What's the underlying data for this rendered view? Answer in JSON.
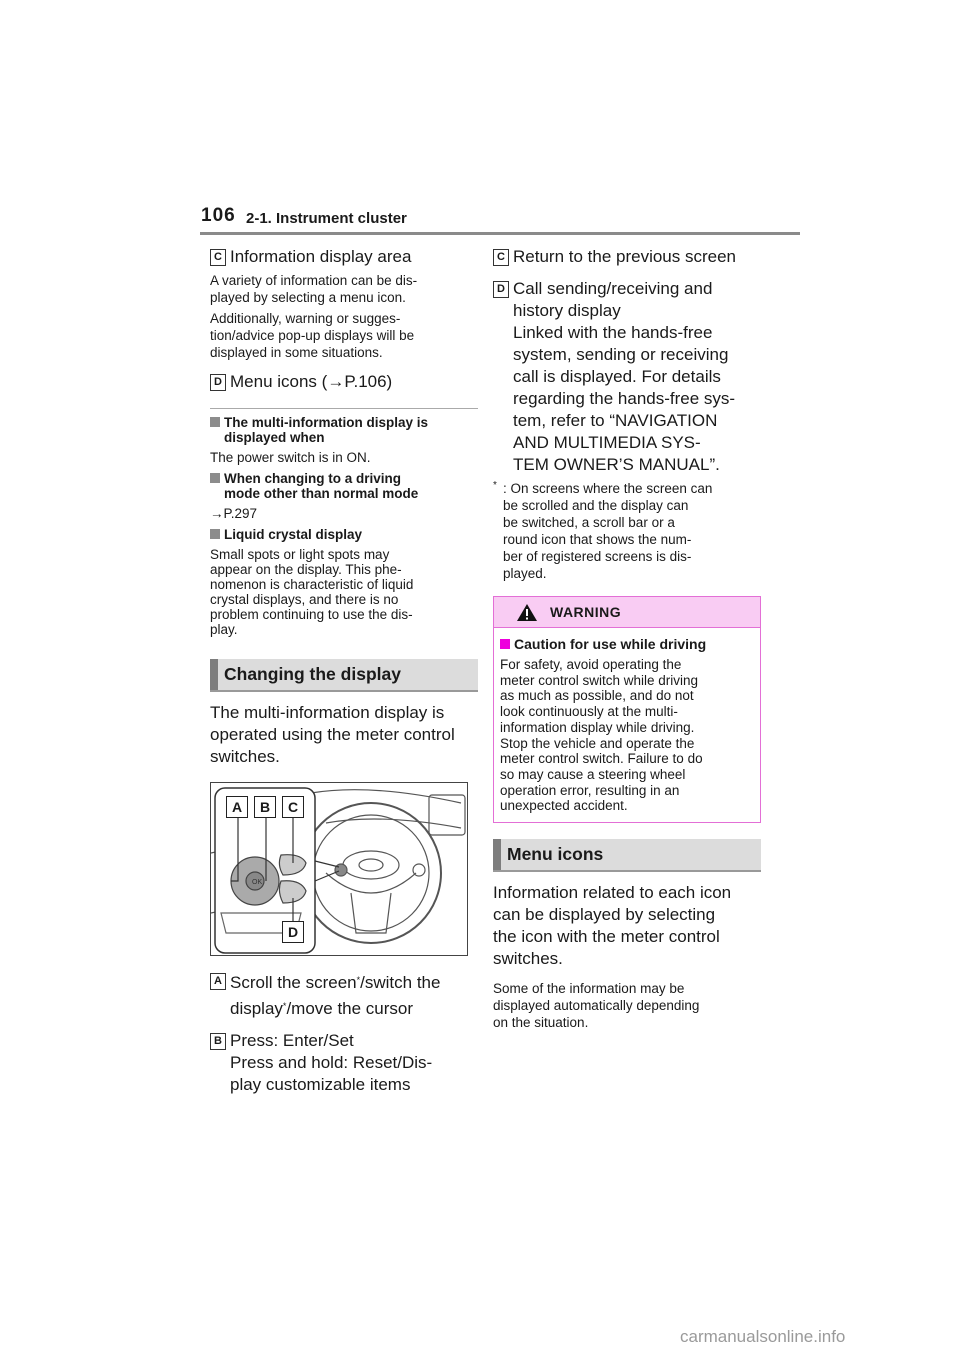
{
  "header": {
    "page_number": "106",
    "section": "2-1. Instrument cluster"
  },
  "left_column": {
    "item_c": {
      "label": "C",
      "title": "Information display area"
    },
    "item_c_desc_1": "A variety of information can be dis-\nplayed by selecting a menu icon.",
    "item_c_desc_2": "Additionally, warning or sugges-\ntion/advice pop-up displays will be\ndisplayed in some situations.",
    "item_d": {
      "label": "D",
      "title": "Menu icons (→P.106)"
    },
    "notes": [
      {
        "heading": "The multi-information display is\ndisplayed when",
        "body": "The power switch is in ON."
      },
      {
        "heading": "When changing to a driving\nmode other than normal mode",
        "body": "→P.297"
      },
      {
        "heading": "Liquid crystal display",
        "body": "Small spots or light spots may\nappear on the display. This phe-\nnomenon is characteristic of liquid\ncrystal displays, and there is no\nproblem continuing to use the dis-\nplay."
      }
    ],
    "changing_heading": "Changing the display",
    "changing_body": "The multi-information display is\noperated using the meter control\nswitches.",
    "figure": {
      "labels": [
        "A",
        "B",
        "C",
        "D"
      ],
      "alt": "Steering wheel meter control switches"
    },
    "item_a": {
      "label": "A",
      "part1": "Scroll the screen",
      "star": "*",
      "part2": "/switch the",
      "part3": "display",
      "part4": "/move the cursor"
    },
    "item_b": {
      "label": "B",
      "text": "Press: Enter/Set\nPress and hold: Reset/Dis-\nplay customizable items"
    }
  },
  "right_column": {
    "item_c": {
      "label": "C",
      "title": "Return to the previous screen"
    },
    "item_d": {
      "label": "D",
      "text": "Call sending/receiving and\nhistory display\nLinked with the hands-free\nsystem, sending or receiving\ncall is displayed. For details\nregarding the hands-free sys-\ntem, refer to “NAVIGATION\nAND MULTIMEDIA SYS-\nTEM OWNER’S MANUAL”."
    },
    "footnote": {
      "star": "*",
      "text": ": On screens where the screen can\nbe scrolled and the display can\nbe switched, a scroll bar or a\nround icon that shows the num-\nber of registered screens is dis-\nplayed."
    },
    "warning": {
      "title": "WARNING",
      "heading": "Caution for use while driving",
      "body": "For safety, avoid operating the\nmeter control switch while driving\nas much as possible, and do not\nlook continuously at the multi-\ninformation display while driving.\nStop the vehicle and operate the\nmeter control switch. Failure to do\nso may cause a steering wheel\noperation error, resulting in an\nunexpected accident."
    },
    "menu_heading": "Menu icons",
    "menu_body": "Information related to each icon\ncan be displayed by selecting\nthe icon with the meter control\nswitches.",
    "menu_small": "Some of the information may be\ndisplayed automatically depending\non the situation."
  },
  "watermark": "carmanualsonline.info",
  "colors": {
    "warning_border": "#e36fd6",
    "warning_header_bg": "#f9ccf3",
    "warning_bullet": "#ee00dd",
    "heading_bar_bg": "#dcdcdc"
  }
}
